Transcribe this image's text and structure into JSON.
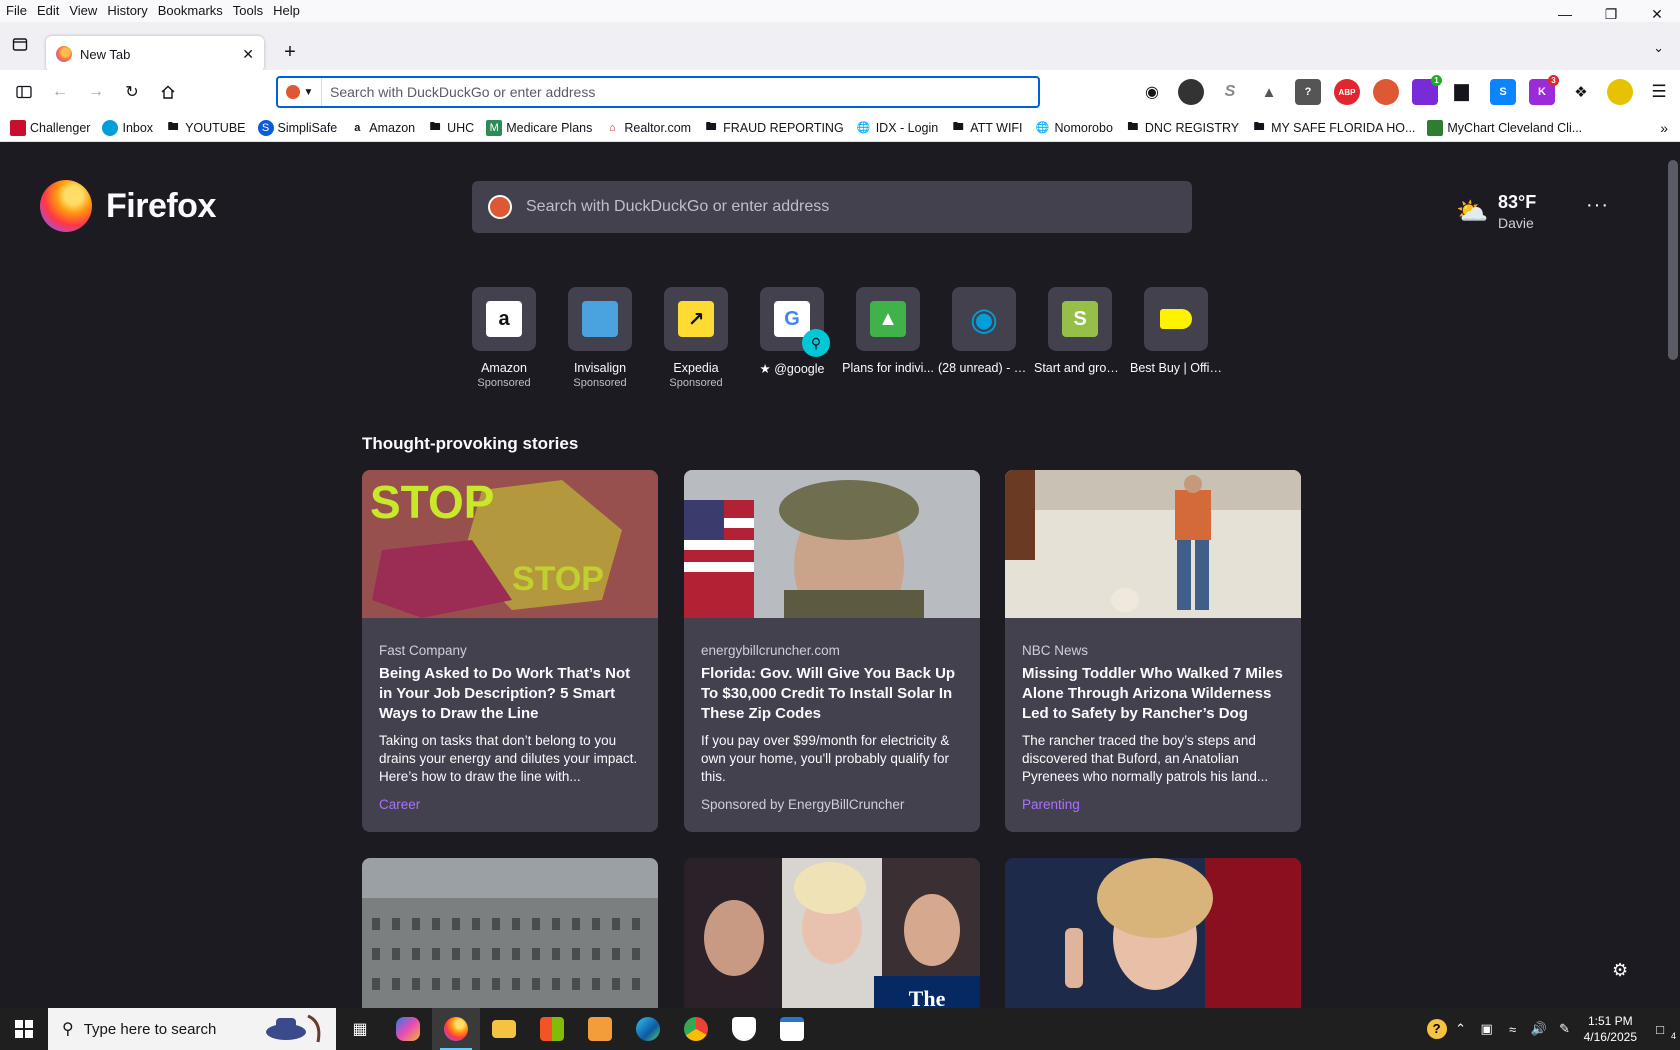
{
  "menubar": {
    "items": [
      "File",
      "Edit",
      "View",
      "History",
      "Bookmarks",
      "Tools",
      "Help"
    ]
  },
  "tab": {
    "title": "New Tab"
  },
  "urlbar": {
    "placeholder": "Search with DuckDuckGo or enter address"
  },
  "bookmarks": [
    {
      "label": "Challenger",
      "icon": "challenger-icon"
    },
    {
      "label": "Inbox",
      "icon": "att-icon"
    },
    {
      "label": "YOUTUBE",
      "icon": "folder-icon"
    },
    {
      "label": "SimpliSafe",
      "icon": "simplisafe-icon"
    },
    {
      "label": "Amazon",
      "icon": "amazon-icon"
    },
    {
      "label": "UHC",
      "icon": "folder-icon"
    },
    {
      "label": "Medicare Plans",
      "icon": "medicare-icon"
    },
    {
      "label": "Realtor.com",
      "icon": "realtor-icon"
    },
    {
      "label": "FRAUD REPORTING",
      "icon": "folder-icon"
    },
    {
      "label": "IDX - Login",
      "icon": "globe-icon"
    },
    {
      "label": "ATT WIFI",
      "icon": "folder-icon"
    },
    {
      "label": "Nomorobo",
      "icon": "globe-icon"
    },
    {
      "label": "DNC REGISTRY",
      "icon": "folder-icon"
    },
    {
      "label": "MY SAFE FLORIDA HO...",
      "icon": "folder-icon"
    },
    {
      "label": "MyChart Cleveland Cli...",
      "icon": "mychart-icon"
    }
  ],
  "newtab": {
    "brand": "Firefox",
    "search_placeholder": "Search with DuckDuckGo or enter address",
    "weather": {
      "temp": "83°F",
      "location": "Davie"
    },
    "top_sites": [
      {
        "label": "Amazon",
        "sub": "Sponsored",
        "glyph": "a",
        "bg": "#ffffff",
        "fg": "#111111"
      },
      {
        "label": "Invisalign",
        "sub": "Sponsored",
        "glyph": "",
        "bg": "#4aa3df",
        "fg": "#ffffff"
      },
      {
        "label": "Expedia",
        "sub": "Sponsored",
        "glyph": "↗",
        "bg": "#fddb32",
        "fg": "#111111"
      },
      {
        "label": "★ @google",
        "sub": "",
        "glyph": "G",
        "bg": "#ffffff",
        "fg": "#4285f4"
      },
      {
        "label": "Plans for indivi...",
        "sub": "",
        "glyph": "▲",
        "bg": "#3fb24a",
        "fg": "#ffffff"
      },
      {
        "label": "(28 unread) - z...",
        "sub": "",
        "glyph": "◉",
        "bg": "#42414d",
        "fg": "#009fdb"
      },
      {
        "label": "Start and grow ...",
        "sub": "",
        "glyph": "S",
        "bg": "#95bf47",
        "fg": "#ffffff"
      },
      {
        "label": "Best Buy | Offici...",
        "sub": "",
        "glyph": "",
        "bg": "#fff200",
        "fg": "#111111"
      }
    ],
    "stories_title": "Thought-provoking stories",
    "stories": [
      {
        "source": "Fast Company",
        "headline": "Being Asked to Do Work That’s Not in Your Job Description? 5 Smart Ways to Draw the Line",
        "excerpt": "Taking on tasks that don’t belong to you drains your energy and dilutes your impact. Here’s how to draw the line with...",
        "context": "Career",
        "context_type": "topic"
      },
      {
        "source": "energybillcruncher.com",
        "headline": "Florida: Gov. Will Give You Back Up To $30,000 Credit To Install Solar In These Zip Codes",
        "excerpt": "If you pay over $99/month for electricity & own your home, you'll probably qualify for this.",
        "context": "Sponsored by EnergyBillCruncher",
        "context_type": "sponsored"
      },
      {
        "source": "NBC News",
        "headline": "Missing Toddler Who Walked 7 Miles Alone Through Arizona Wilderness Led to Safety by Rancher’s Dog",
        "excerpt": "The rancher traced the boy’s steps and discovered that Buford, an Anatolian Pyrenees who normally patrols his land...",
        "context": "Parenting",
        "context_type": "topic"
      }
    ]
  },
  "taskbar": {
    "search_placeholder": "Type here to search",
    "time": "1:51 PM",
    "date": "4/16/2025",
    "notifications": "4"
  },
  "colors": {
    "accent": "#0061e0",
    "page_bg": "#1c1b22",
    "card_bg": "#42414d",
    "topic": "#ab71ff"
  }
}
